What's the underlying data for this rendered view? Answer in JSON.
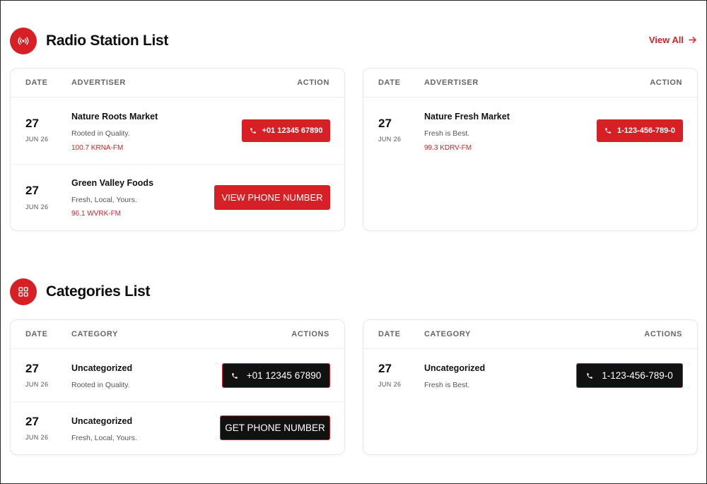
{
  "colors": {
    "accent": "#d71f26",
    "dark": "#111111"
  },
  "radio": {
    "icon": "radio-broadcast-icon",
    "title": "Radio Station List",
    "view_all": "View All",
    "cards": [
      {
        "headers": {
          "date": "DATE",
          "name": "ADVERTISER",
          "action": "ACTION"
        },
        "rows": [
          {
            "day": "27",
            "month": "JUN 26",
            "name": "Nature Roots Market",
            "tagline": "Rooted in Quality.",
            "station": "100.7 KRNA-FM",
            "button": "+01 12345 67890"
          },
          {
            "day": "27",
            "month": "JUN 26",
            "name": "Green Valley Foods",
            "tagline": "Fresh, Local, Yours.",
            "station": "96.1 WVRK-FM",
            "button": "VIEW PHONE NUMBER"
          }
        ]
      },
      {
        "headers": {
          "date": "DATE",
          "name": "ADVERTISER",
          "action": "ACTION"
        },
        "rows": [
          {
            "day": "27",
            "month": "JUN 26",
            "name": "Nature Fresh Market",
            "tagline": "Fresh is Best.",
            "station": "99.3 KDRV-FM",
            "button": "1-123-456-789-0"
          }
        ]
      }
    ]
  },
  "categories": {
    "icon": "grid-icon",
    "title": "Categories List",
    "cards": [
      {
        "headers": {
          "date": "DATE",
          "name": "CATEGORY",
          "action": "ACTIONS"
        },
        "rows": [
          {
            "day": "27",
            "month": "JUN 26",
            "name": "Uncategorized",
            "tagline": "Rooted in Quality.",
            "button": "+01 12345 67890"
          },
          {
            "day": "27",
            "month": "JUN 26",
            "name": "Uncategorized",
            "tagline": "Fresh, Local, Yours.",
            "button": "GET PHONE NUMBER"
          }
        ]
      },
      {
        "headers": {
          "date": "DATE",
          "name": "CATEGORY",
          "action": "ACTIONS"
        },
        "rows": [
          {
            "day": "27",
            "month": "JUN 26",
            "name": "Uncategorized",
            "tagline": "Fresh is Best.",
            "button": "1-123-456-789-0"
          }
        ]
      }
    ]
  }
}
